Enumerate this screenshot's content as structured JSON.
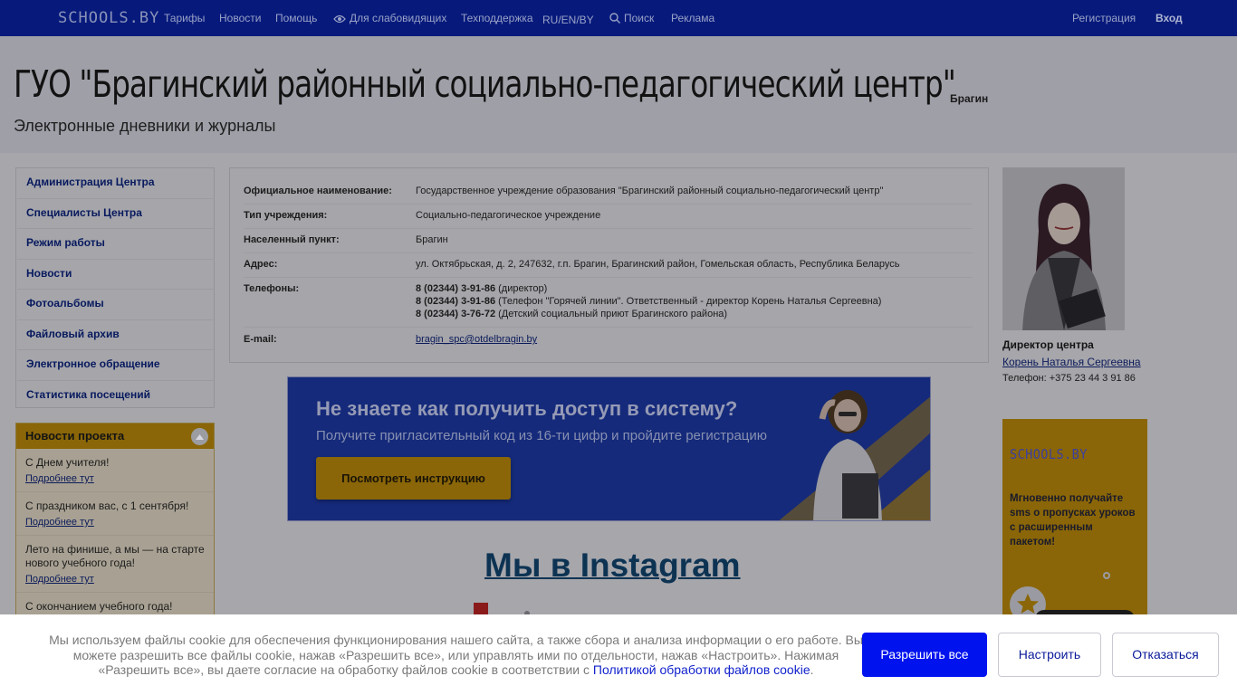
{
  "topbar": {
    "logo": "SCHOOLS.BY",
    "nav": [
      "Тарифы",
      "Новости",
      "Помощь",
      "Для слабовидящих",
      "Техподдержка",
      "RU/EN/BY",
      "Поиск",
      "Реклама"
    ],
    "register": "Регистрация",
    "login": "Вход"
  },
  "header": {
    "title": "ГУО \"Брагинский районный социально-педагогический центр\"",
    "city": "Брагин",
    "subtitle": "Электронные дневники и журналы"
  },
  "sidebar": {
    "items": [
      "Администрация Центра",
      "Специалисты Центра",
      "Режим работы",
      "Новости",
      "Фотоальбомы",
      "Файловый архив",
      "Электронное обращение",
      "Статистика посещений"
    ]
  },
  "project_news": {
    "title": "Новости проекта",
    "more_label": "Подробнее тут",
    "items": [
      "С Днем учителя!",
      "С праздником вас, с 1 сентября!",
      "Лето на финише, а мы — на старте нового учебного года!",
      "С окончанием учебного года!"
    ]
  },
  "info": {
    "official_name_label": "Официальное наименование:",
    "official_name": "Государственное учреждение образования \"Брагинский районный социально-педагогический центр\"",
    "type_label": "Тип учреждения:",
    "type": "Социально-педагогическое учреждение",
    "settlement_label": "Населенный пункт:",
    "settlement": "Брагин",
    "address_label": "Адрес:",
    "address": "ул. Октябрьская, д. 2, 247632, г.п. Брагин, Брагинский район, Гомельская область, Республика Беларусь",
    "phones_label": "Телефоны:",
    "phones": [
      {
        "number": "8 (02344) 3-91-86",
        "note": " (директор)"
      },
      {
        "number": "8 (02344) 3-91-86",
        "note": " (Телефон \"Горячей линии\". Ответственный - директор Корень Наталья Сергеевна)"
      },
      {
        "number": "8 (02344) 3-76-72",
        "note": " (Детский социальный приют Брагинского района)"
      }
    ],
    "email_label": "E-mail:",
    "email": "bragin_spc@otdelbragin.by"
  },
  "banner": {
    "title": "Не знаете как получить доступ в систему?",
    "subtitle": "Получите пригласительный код из 16-ти цифр и пройдите регистрацию",
    "button": "Посмотреть инструкцию"
  },
  "instagram": {
    "title": "Мы в Instagram"
  },
  "director": {
    "label": "Директор центра",
    "name": "Корень Наталья Сергеевна",
    "phone": "Телефон: +375 23 44 3 91 86"
  },
  "ad": {
    "logo": "SCHOOLS.BY",
    "text": "Мгновенно получайте sms о пропусках уроков с расширенным пакетом!"
  },
  "cookie": {
    "text_before_link": "Мы используем файлы cookie для обеспечения функционирования нашего сайта, а также сбора и анализа информации о его работе. Вы можете разрешить все файлы cookie, нажав «Разрешить все», или управлять ими по отдельности, нажав «Настроить». Нажимая «Разрешить все», вы даете согласие на обработку файлов cookie в соответствии с ",
    "link": "Политикой обработки файлов cookie",
    "text_after_link": ".",
    "allow_all": "Разрешить все",
    "settings": "Настроить",
    "decline": "Отказаться"
  },
  "colors": {
    "topbar": "#071a7c",
    "accent_blue": "#0012ee",
    "news_header": "#8a6608",
    "overlay_bg": "#a6a6ab"
  }
}
